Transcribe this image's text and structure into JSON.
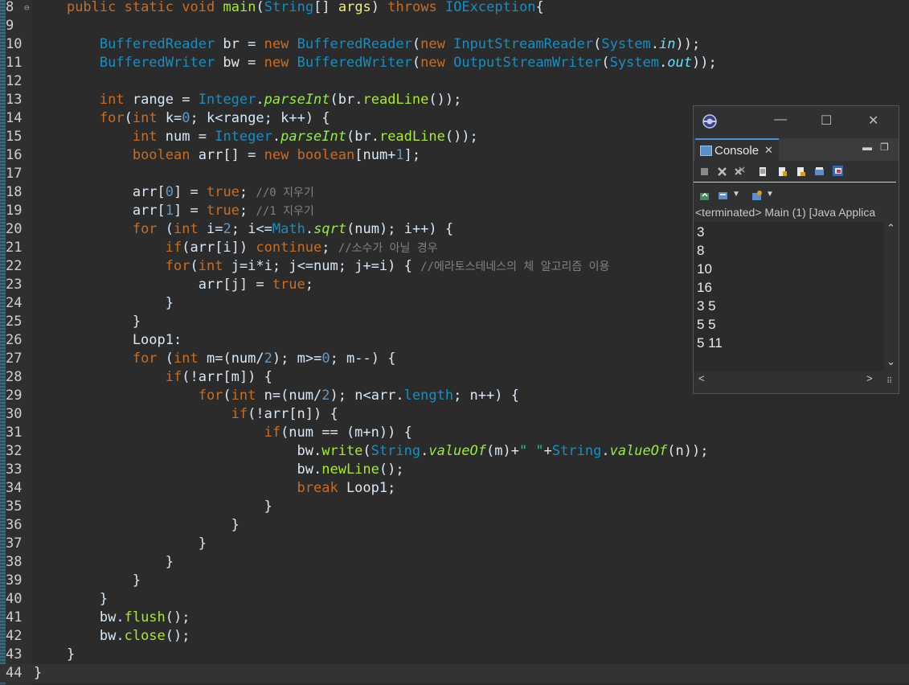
{
  "editor": {
    "lines": [
      {
        "n": "8",
        "fold": "⊖",
        "html": "    <span class=\"kw\">public</span> <span class=\"kw\">static</span> <span class=\"kw\">void</span> <span class=\"fn\">main</span>(<span class=\"cls\">String</span>[] <span class=\"var\">args</span>) <span class=\"kw\">throws</span> <span class=\"cls\">IOException</span>{"
      },
      {
        "n": "9",
        "html": ""
      },
      {
        "n": "10",
        "html": "        <span class=\"cls\">BufferedReader</span> br = <span class=\"kw\">new</span> <span class=\"cls\">BufferedReader</span>(<span class=\"kw\">new</span> <span class=\"cls\">InputStreamReader</span>(<span class=\"cls\">System</span>.<span class=\"fld\">in</span>));"
      },
      {
        "n": "11",
        "html": "        <span class=\"cls\">BufferedWriter</span> bw = <span class=\"kw\">new</span> <span class=\"cls\">BufferedWriter</span>(<span class=\"kw\">new</span> <span class=\"cls\">OutputStreamWriter</span>(<span class=\"cls\">System</span>.<span class=\"fld\">out</span>));"
      },
      {
        "n": "12",
        "html": ""
      },
      {
        "n": "13",
        "html": "        <span class=\"kw\">int</span> range = <span class=\"cls\">Integer</span>.<span class=\"stat\">parseInt</span>(br.<span class=\"fn\">readLine</span>());"
      },
      {
        "n": "14",
        "html": "        <span class=\"kw\">for</span>(<span class=\"kw\">int</span> k=<span class=\"num\">0</span>; k&lt;range; k++) {"
      },
      {
        "n": "15",
        "html": "            <span class=\"kw\">int</span> num = <span class=\"cls\">Integer</span>.<span class=\"stat\">parseInt</span>(br.<span class=\"fn\">readLine</span>());"
      },
      {
        "n": "16",
        "html": "            <span class=\"kw\">boolean</span> arr[] = <span class=\"kw\">new</span> <span class=\"kw\">boolean</span>[num+<span class=\"num\">1</span>];"
      },
      {
        "n": "17",
        "html": ""
      },
      {
        "n": "18",
        "html": "            arr[<span class=\"num\">0</span>] = <span class=\"kw\">true</span>; <span class=\"cmt\">//0 지우기</span>"
      },
      {
        "n": "19",
        "html": "            arr[<span class=\"num\">1</span>] = <span class=\"kw\">true</span>; <span class=\"cmt\">//1 지우기</span>"
      },
      {
        "n": "20",
        "html": "            <span class=\"kw\">for</span> (<span class=\"kw\">int</span> i=<span class=\"num\">2</span>; i&lt;=<span class=\"cls\">Math</span>.<span class=\"stat\">sqrt</span>(num); i++) {"
      },
      {
        "n": "21",
        "html": "                <span class=\"kw\">if</span>(arr[i]) <span class=\"kw\">continue</span>; <span class=\"cmt\">//소수가 아닐 경우</span>"
      },
      {
        "n": "22",
        "html": "                <span class=\"kw\">for</span>(<span class=\"kw\">int</span> j=i*i; j&lt;=num; j+=i) { <span class=\"cmt\">//에라토스테네스의 체 알고리즘 이용</span>"
      },
      {
        "n": "23",
        "html": "                    arr[j] = <span class=\"kw\">true</span>;"
      },
      {
        "n": "24",
        "html": "                }"
      },
      {
        "n": "25",
        "html": "            }"
      },
      {
        "n": "26",
        "html": "            Loop1:"
      },
      {
        "n": "27",
        "html": "            <span class=\"kw\">for</span> (<span class=\"kw\">int</span> m=(num/<span class=\"num\">2</span>); m&gt;=<span class=\"num\">0</span>; m--) {"
      },
      {
        "n": "28",
        "html": "                <span class=\"kw\">if</span>(!arr[m]) {"
      },
      {
        "n": "29",
        "html": "                    <span class=\"kw\">for</span>(<span class=\"kw\">int</span> n=(num/<span class=\"num\">2</span>); n&lt;arr.<span class=\"cls\">length</span>; n++) {"
      },
      {
        "n": "30",
        "html": "                        <span class=\"kw\">if</span>(!arr[n]) {"
      },
      {
        "n": "31",
        "html": "                            <span class=\"kw\">if</span>(num == (m+n)) {"
      },
      {
        "n": "32",
        "html": "                                bw.<span class=\"fn\">write</span>(<span class=\"cls\">String</span>.<span class=\"stat\">valueOf</span>(m)+<span class=\"str\">\" \"</span>+<span class=\"cls\">String</span>.<span class=\"stat\">valueOf</span>(n));"
      },
      {
        "n": "33",
        "html": "                                bw.<span class=\"fn\">newLine</span>();"
      },
      {
        "n": "34",
        "html": "                                <span class=\"kw\">break</span> Loop1;"
      },
      {
        "n": "35",
        "html": "                            }"
      },
      {
        "n": "36",
        "html": "                        }"
      },
      {
        "n": "37",
        "html": "                    }"
      },
      {
        "n": "38",
        "html": "                }"
      },
      {
        "n": "39",
        "html": "            }"
      },
      {
        "n": "40",
        "html": "        }"
      },
      {
        "n": "41",
        "html": "        bw.<span class=\"fn\">flush</span>();"
      },
      {
        "n": "42",
        "html": "        bw.<span class=\"fn\">close</span>();"
      },
      {
        "n": "43",
        "html": "    }"
      },
      {
        "n": "44",
        "html": "}",
        "current": true
      }
    ]
  },
  "console": {
    "tab_label": "Console",
    "status": "<terminated> Main (1) [Java Applica",
    "output": [
      "3",
      "8",
      "10",
      "16",
      "3 5",
      "5 5",
      "5 11"
    ],
    "accent": "#4a90d9"
  },
  "window": {
    "minimize": "—",
    "maximize": "☐",
    "close": "✕"
  }
}
